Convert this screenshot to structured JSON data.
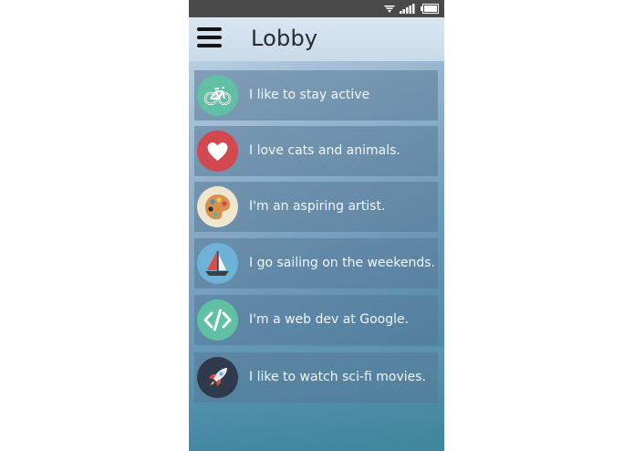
{
  "app": {
    "title": "Lobby"
  },
  "statusbar": {
    "icons": [
      "wifi-icon",
      "signal-icon",
      "battery-icon"
    ]
  },
  "colors": {
    "statusbar": "#4a4a4a",
    "appbar": "#cfe0ed",
    "item_bg": "rgba(85,120,150,0.55)"
  },
  "interests": [
    {
      "label": "I like to stay active",
      "icon": "bicycle-icon",
      "icon_bg": "#5fc0a4"
    },
    {
      "label": "I love cats and animals.",
      "icon": "heart-icon",
      "icon_bg": "#d2484f"
    },
    {
      "label": "I'm an aspiring artist.",
      "icon": "palette-icon",
      "icon_bg": "#efe6d0"
    },
    {
      "label": "I go sailing on the weekends.",
      "icon": "sailboat-icon",
      "icon_bg": "#6fb2d8"
    },
    {
      "label": "I'm a web dev at Google.",
      "icon": "code-icon",
      "icon_bg": "#5fc0a4"
    },
    {
      "label": "I like to watch sci-fi movies.",
      "icon": "rocket-icon",
      "icon_bg": "#2f3b4c"
    }
  ]
}
